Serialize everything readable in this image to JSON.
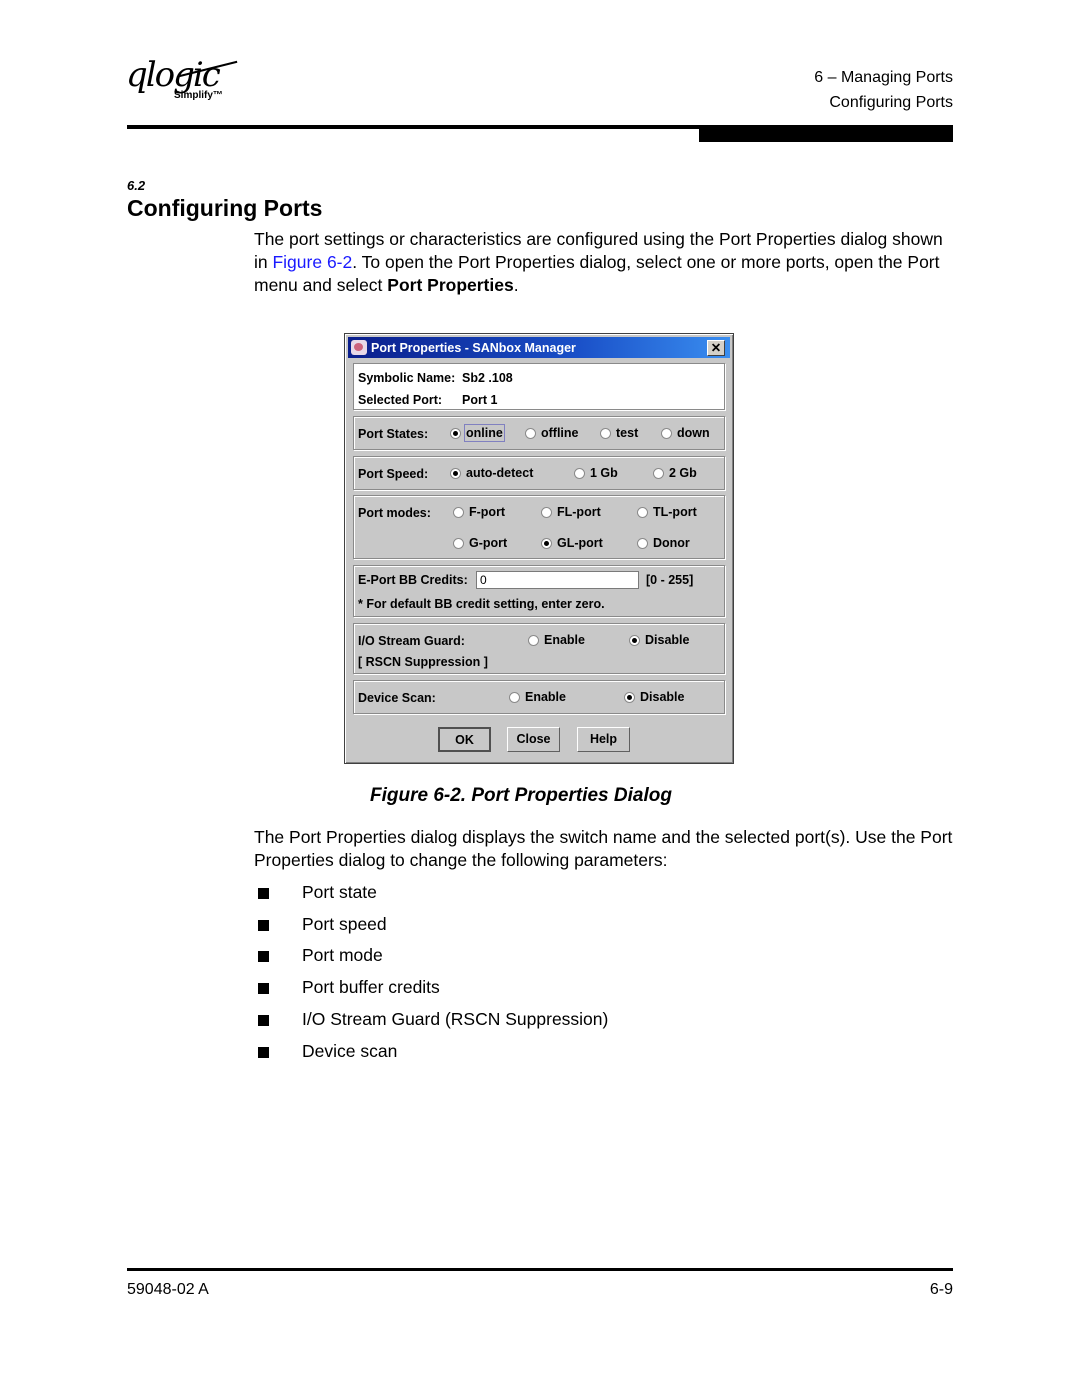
{
  "header": {
    "logo_word": "qlogic",
    "logo_tagline": "Simplify™",
    "chapter": "6 – Managing Ports",
    "section": "Configuring Ports"
  },
  "section": {
    "number": "6.2",
    "title": "Configuring Ports"
  },
  "intro": {
    "part1": "The port settings or characteristics are configured using the Port Properties dialog shown in ",
    "link": "Figure 6-2",
    "part2": ". To open the Port Properties dialog, select one or more ports, open the Port menu and select ",
    "bold": "Port Properties",
    "part3": "."
  },
  "dialog": {
    "title": "Port Properties - SANbox Manager",
    "close_glyph": "✕",
    "symbolic_name_label": "Symbolic Name:",
    "symbolic_name_value": "Sb2 .108",
    "selected_port_label": "Selected Port:",
    "selected_port_value": "Port 1",
    "port_states": {
      "label": "Port States:",
      "options": [
        "online",
        "offline",
        "test",
        "down"
      ],
      "selected": "online"
    },
    "port_speed": {
      "label": "Port Speed:",
      "options": [
        "auto-detect",
        "1 Gb",
        "2 Gb"
      ],
      "selected": "auto-detect"
    },
    "port_modes": {
      "label": "Port modes:",
      "options": [
        "F-port",
        "FL-port",
        "TL-port",
        "G-port",
        "GL-port",
        "Donor"
      ],
      "selected": "GL-port"
    },
    "bb_credits": {
      "label": "E-Port BB Credits:",
      "value": "0",
      "range": "[0 - 255]",
      "note": "* For default BB credit setting, enter zero."
    },
    "io_stream_guard": {
      "label": "I/O Stream Guard:",
      "sublabel": "[ RSCN Suppression ]",
      "options": [
        "Enable",
        "Disable"
      ],
      "selected": "Disable"
    },
    "device_scan": {
      "label": "Device Scan:",
      "options": [
        "Enable",
        "Disable"
      ],
      "selected": "Disable"
    },
    "buttons": {
      "ok": "OK",
      "close": "Close",
      "help": "Help"
    }
  },
  "figure_caption": "Figure 6-2.  Port Properties Dialog",
  "body": {
    "paragraph": "The Port Properties dialog displays the switch name and the selected port(s). Use the Port Properties dialog to change the following parameters:",
    "bullets": [
      "Port state",
      "Port speed",
      "Port mode",
      "Port buffer credits",
      "I/O Stream Guard (RSCN Suppression)",
      "Device scan"
    ]
  },
  "footer": {
    "doc_number": "59048-02  A",
    "page": "6-9"
  },
  "colors": {
    "link": "#1a1aff",
    "titlebar": "#0a1e8c"
  }
}
